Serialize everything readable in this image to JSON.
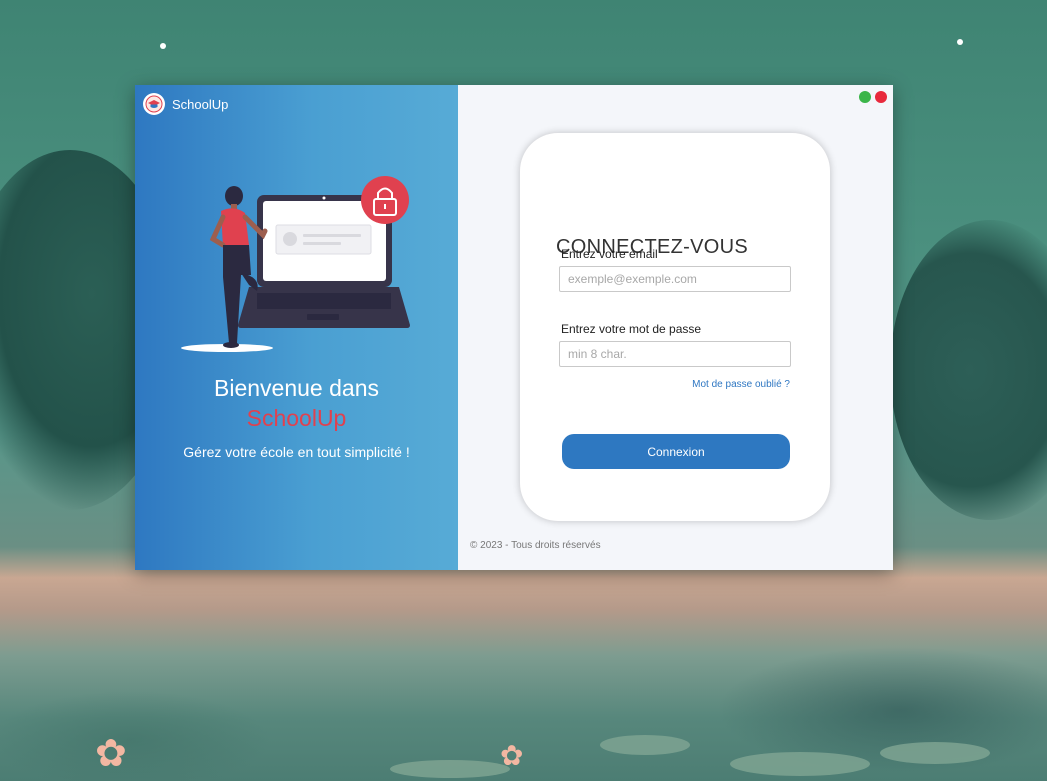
{
  "app": {
    "name": "SchoolUp"
  },
  "welcome": {
    "line1": "Bienvenue dans",
    "line2": "SchoolUp",
    "tagline": "Gérez votre école en tout simplicité !"
  },
  "login": {
    "title": "CONNECTEZ-VOUS",
    "email_label": "Entrez votre email",
    "email_placeholder": "exemple@exemple.com",
    "email_value": "",
    "password_label": "Entrez votre mot de passe",
    "password_placeholder": "min 8 char.",
    "password_value": "",
    "forgot_link": "Mot de passe oublié ?",
    "submit_label": "Connexion"
  },
  "footer": {
    "copyright": "© 2023 - Tous droits réservés"
  },
  "colors": {
    "primary": "#2e78c1",
    "accent": "#e0414f",
    "window_minimize": "#3bb54a",
    "window_close": "#e8293c"
  },
  "icons": {
    "brand": "graduation-cap-icon",
    "lock": "lock-icon"
  }
}
